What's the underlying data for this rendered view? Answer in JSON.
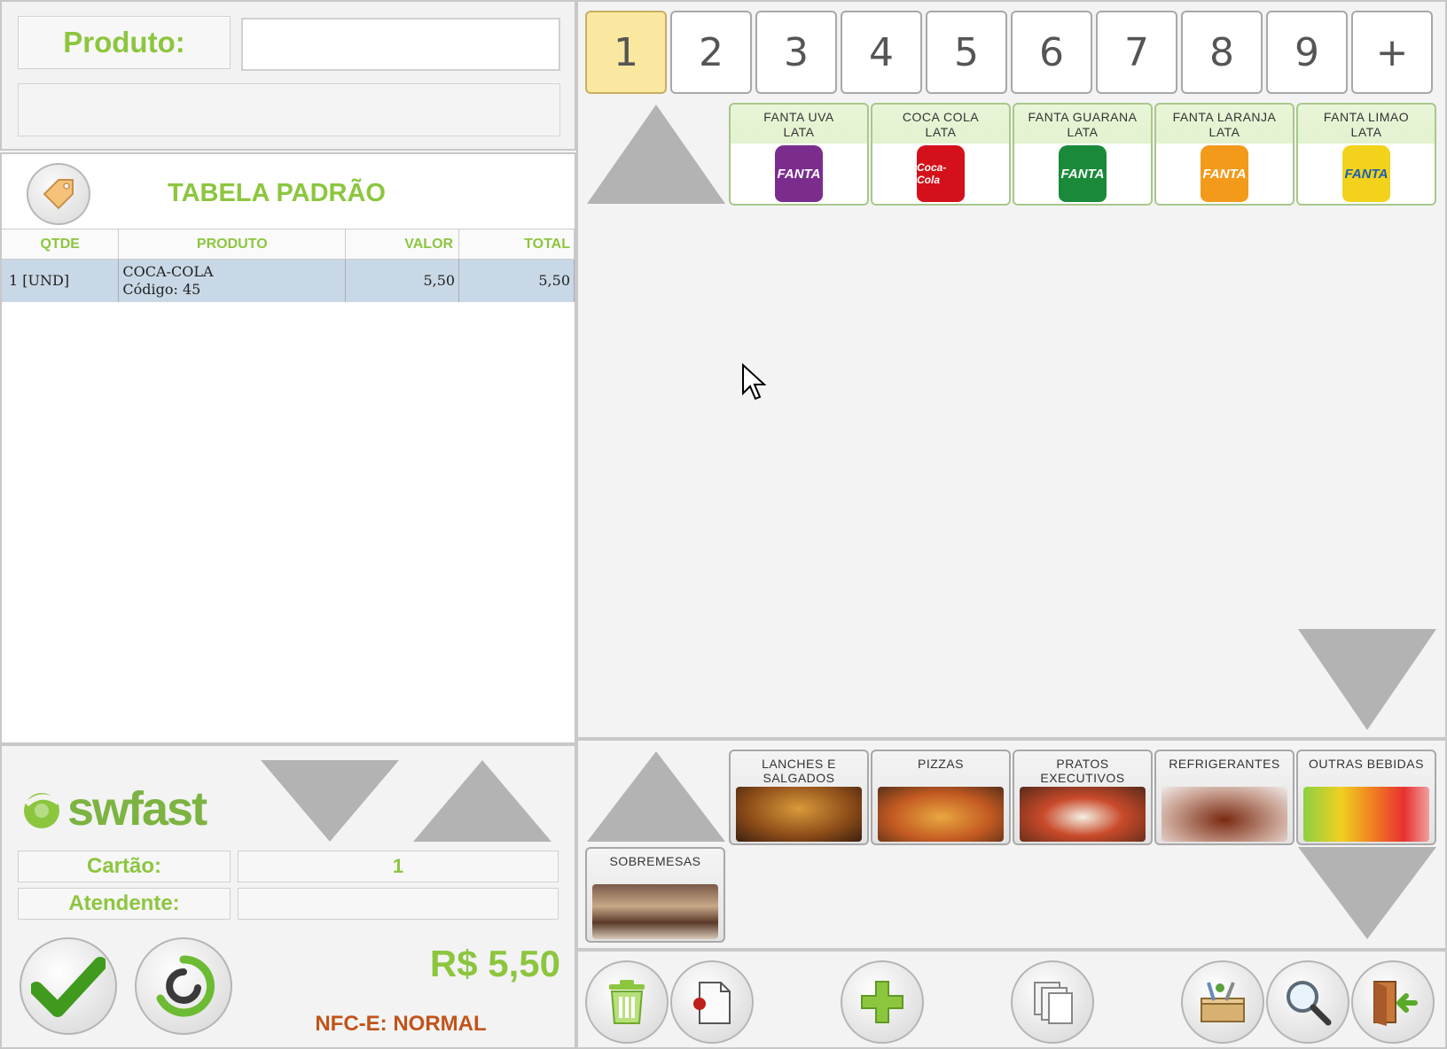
{
  "produto": {
    "label": "Produto:",
    "value": "",
    "placeholder": ""
  },
  "tabela": {
    "title": "TABELA PADRÃO"
  },
  "table": {
    "headers": {
      "qtde": "QTDE",
      "produto": "PRODUTO",
      "valor": "VALOR",
      "total": "TOTAL"
    },
    "rows": [
      {
        "qtde": "1 [UND]",
        "produto": "COCA-COLA",
        "codigo": "Código: 45",
        "valor": "5,50",
        "total": "5,50"
      }
    ]
  },
  "brand": {
    "logo_text": "swfast"
  },
  "info": {
    "cartao_label": "Cartão:",
    "cartao_value": "1",
    "atendente_label": "Atendente:",
    "atendente_value": ""
  },
  "total": "R$ 5,50",
  "nfce": "NFC-E: NORMAL",
  "pages": [
    "1",
    "2",
    "3",
    "4",
    "5",
    "6",
    "7",
    "8",
    "9",
    "+"
  ],
  "products": [
    {
      "name": "FANTA UVA LATA",
      "l1": "FANTA UVA",
      "l2": "LATA",
      "brand": "FANTA",
      "color": "#7b2d8e"
    },
    {
      "name": "COCA COLA LATA",
      "l1": "COCA COLA",
      "l2": "LATA",
      "brand": "Coca-Cola",
      "color": "#d4111a"
    },
    {
      "name": "FANTA GUARANA LATA",
      "l1": "FANTA GUARANA",
      "l2": "LATA",
      "brand": "FANTA",
      "color": "#1a8a3a"
    },
    {
      "name": "FANTA LARANJA LATA",
      "l1": "FANTA LARANJA",
      "l2": "LATA",
      "brand": "FANTA",
      "color": "#f39a1b"
    },
    {
      "name": "FANTA LIMAO LATA",
      "l1": "FANTA LIMAO",
      "l2": "LATA",
      "brand": "FANTA",
      "color": "#f2d21a"
    }
  ],
  "categories": [
    {
      "l1": "LANCHES E",
      "l2": "SALGADOS"
    },
    {
      "l1": "PIZZAS",
      "l2": ""
    },
    {
      "l1": "PRATOS",
      "l2": "EXECUTIVOS"
    },
    {
      "l1": "REFRIGERANTES",
      "l2": ""
    },
    {
      "l1": "OUTRAS BEBIDAS",
      "l2": ""
    },
    {
      "l1": "SOBREMESAS",
      "l2": ""
    }
  ],
  "colors": {
    "accent": "#8cc63f",
    "nfce": "#c0541a",
    "selected_row": "#c9d8e6",
    "active_page": "#fbe8a0"
  }
}
